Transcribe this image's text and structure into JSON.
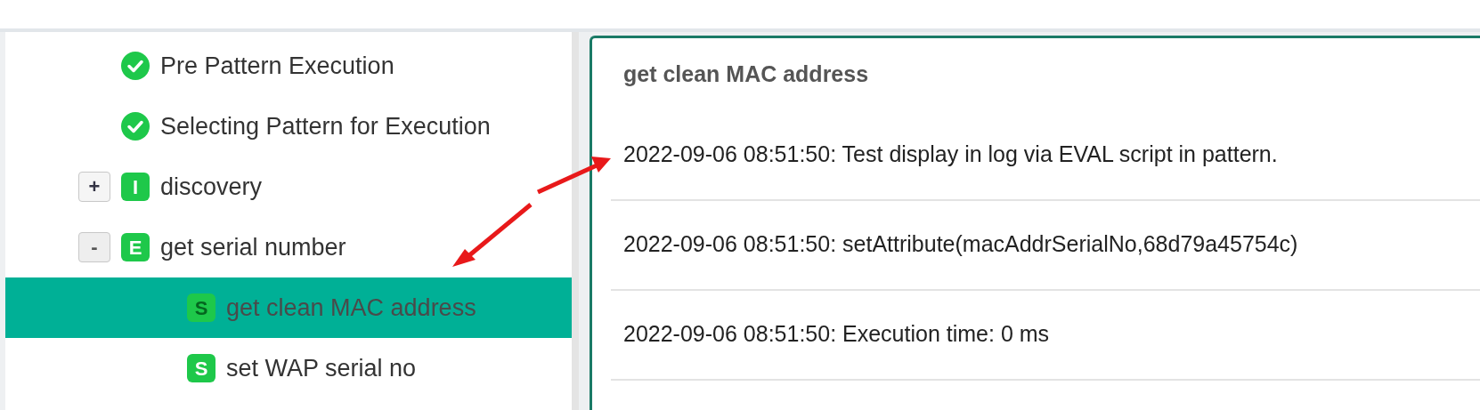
{
  "tree": [
    {
      "kind": "status",
      "label": "Pre Pattern Execution",
      "selected": false
    },
    {
      "kind": "status",
      "label": "Selecting Pattern for Execution",
      "selected": false
    },
    {
      "kind": "node",
      "badge": "I",
      "label": "discovery",
      "expander": "+",
      "expanded": false,
      "selected": false
    },
    {
      "kind": "node",
      "badge": "E",
      "label": "get serial number",
      "expander": "-",
      "expanded": true,
      "selected": false,
      "children": [
        {
          "kind": "leaf",
          "badge": "S",
          "label": "get clean MAC address",
          "selected": true
        },
        {
          "kind": "leaf",
          "badge": "S",
          "label": "set WAP serial no",
          "selected": false
        }
      ]
    }
  ],
  "detail": {
    "title": "get clean MAC address",
    "log": [
      "2022-09-06 08:51:50: Test display in log via EVAL script in pattern.",
      "2022-09-06 08:51:50: setAttribute(macAddrSerialNo,68d79a45754c)",
      "2022-09-06 08:51:50: Execution time: 0 ms"
    ]
  }
}
